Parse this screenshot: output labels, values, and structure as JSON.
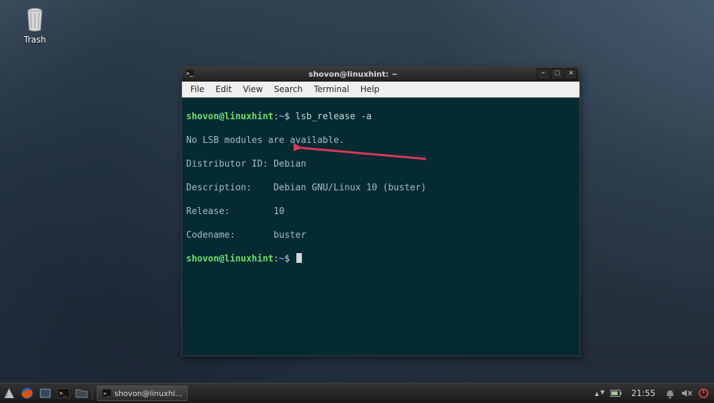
{
  "desktop": {
    "trash_label": "Trash"
  },
  "terminal": {
    "title": "shovon@linuxhint: ~",
    "menubar": {
      "file": "File",
      "edit": "Edit",
      "view": "View",
      "search": "Search",
      "terminal": "Terminal",
      "help": "Help"
    },
    "prompt_user": "shovon@linuxhint",
    "prompt_sep": ":",
    "prompt_path": "~",
    "prompt_symbol": "$",
    "command": "lsb_release -a",
    "output": {
      "no_modules": "No LSB modules are available.",
      "distributor_label": "Distributor ID:",
      "distributor_value": "Debian",
      "description_label": "Description:",
      "description_value": "Debian GNU/Linux 10 (buster)",
      "release_label": "Release:",
      "release_value": "10",
      "codename_label": "Codename:",
      "codename_value": "buster"
    },
    "win_controls": {
      "minimize": "–",
      "maximize": "▢",
      "close": "×"
    }
  },
  "panel": {
    "task_label": "shovon@linuxhi...",
    "clock": "21:55"
  }
}
